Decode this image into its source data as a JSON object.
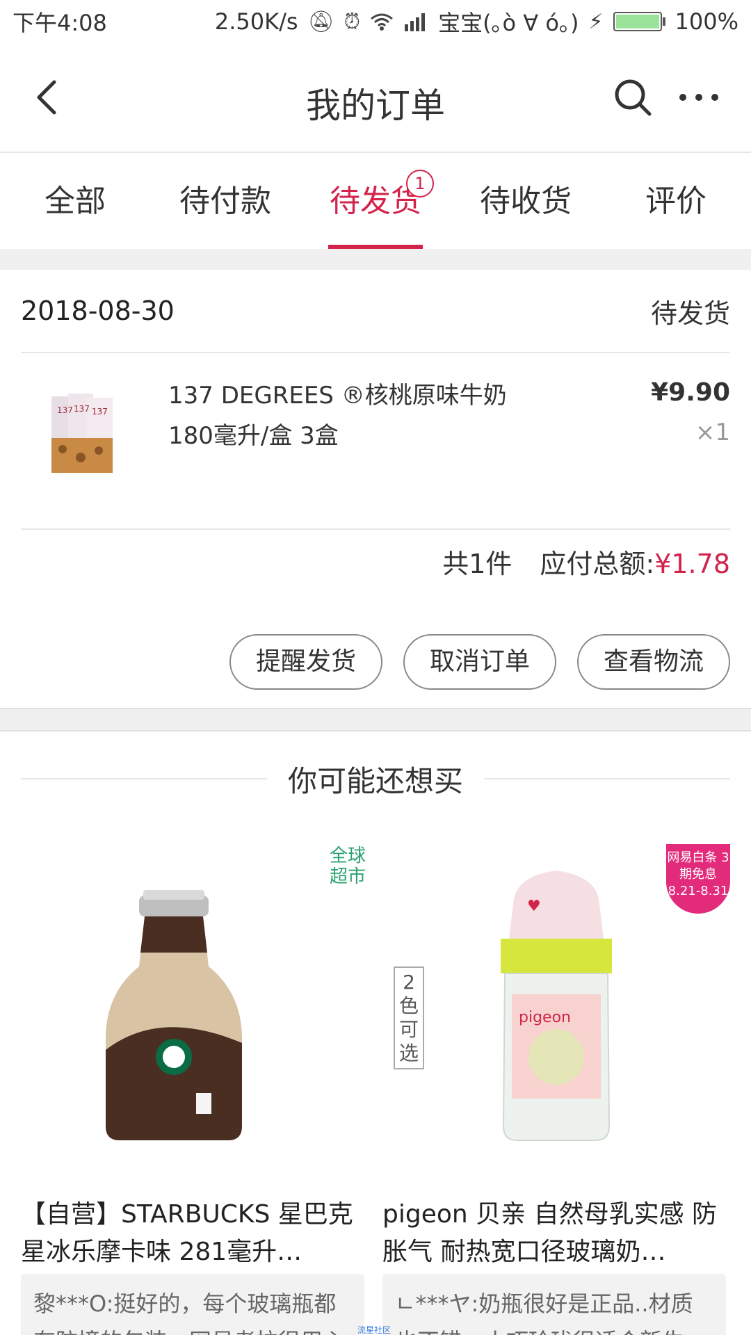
{
  "status_bar": {
    "time": "下午4:08",
    "speed": "2.50K/s",
    "carrier": "宝宝(｡ò ∀ ó｡)",
    "battery": "100%",
    "battery_level": 1.0,
    "icons": [
      "mute-icon",
      "alarm-icon",
      "wifi-icon",
      "signal-icon",
      "charging-icon",
      "battery-icon"
    ]
  },
  "navbar": {
    "title": "我的订单",
    "icons": [
      "back-arrow-icon",
      "search-icon",
      "more-icon"
    ]
  },
  "tabs": [
    {
      "label": "全部"
    },
    {
      "label": "待付款"
    },
    {
      "label": "待发货",
      "badge": "1",
      "active": true
    },
    {
      "label": "待收货"
    },
    {
      "label": "评价"
    }
  ],
  "order": {
    "date": "2018-08-30",
    "status": "待发货",
    "item": {
      "name": "137 DEGREES ®核桃原味牛奶 180毫升/盒 3盒",
      "price": "¥9.90",
      "qty": "×1"
    },
    "count": "共1件",
    "total_label": "应付总额:",
    "total": "¥1.78",
    "buttons": [
      "提醒发货",
      "取消订单",
      "查看物流"
    ]
  },
  "recommend": {
    "title": "你可能还想买",
    "products": [
      {
        "tag": "全球超市",
        "name": "【自营】STARBUCKS 星巴克 星冰乐摩卡味 281毫升…",
        "review": "黎***O:挺好的，每个玻璃瓶都有防撞的包装，网易考拉很用心"
      },
      {
        "tag": "2色可选",
        "promo": "网易白条 3期免息 8.21-8.31",
        "name": "pigeon 贝亲 自然母乳实感 防胀气 耐热宽口径玻璃奶…",
        "review": "ㄴ***ヤ:奶瓶很好是正品..材质也不错，小巧玲珑很适合新生"
      }
    ]
  },
  "watermark": "流星社区",
  "colors": {
    "accent": "#d3234b",
    "green_tag": "#2aa36e",
    "promo_pink": "#e22b7a"
  }
}
